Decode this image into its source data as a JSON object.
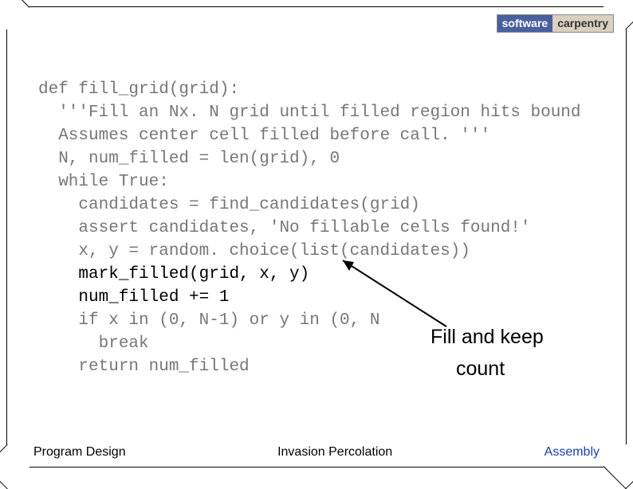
{
  "logo": {
    "left": "software",
    "right": "carpentry"
  },
  "code": {
    "l1": "def fill_grid(grid):",
    "l2": "  '''Fill an Nx. N grid until filled region hits bound",
    "l3": "  Assumes center cell filled before call. '''",
    "l4": "  N, num_filled = len(grid), 0",
    "l5": "  while True:",
    "l6": "    candidates = find_candidates(grid)",
    "l7": "    assert candidates, 'No fillable cells found!'",
    "l8": "    x, y = random. choice(list(candidates))",
    "l9": "    mark_filled(grid, x, y)",
    "l10": "    num_filled += 1",
    "l11a": "    if x in (0, N-1) or y in (0, N",
    "l12": "      break",
    "l13": "    return num_filled"
  },
  "annotation": {
    "line1": "Fill and keep",
    "line2": "count"
  },
  "footer": {
    "left": "Program Design",
    "center": "Invasion Percolation",
    "right": "Assembly"
  }
}
